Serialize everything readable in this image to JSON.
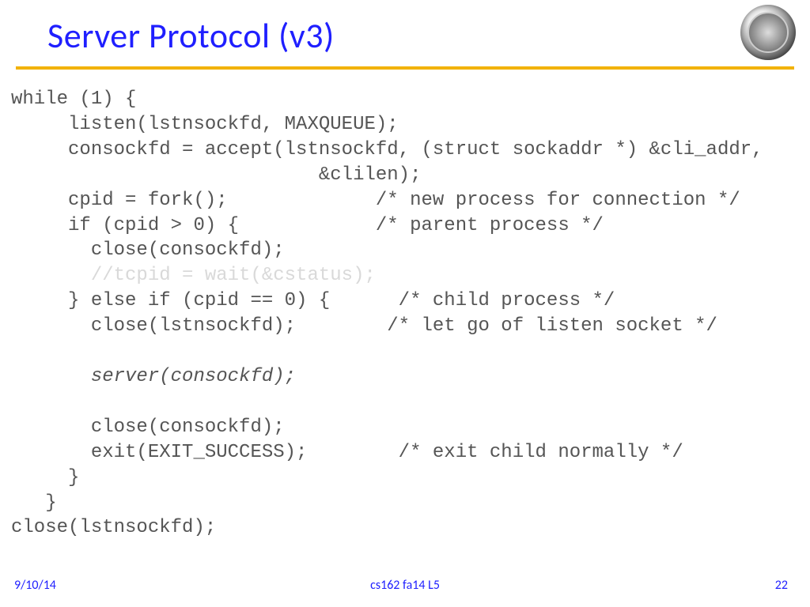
{
  "header": {
    "title": "Server Protocol (v3)",
    "logo_alt": "university-seal"
  },
  "code": {
    "l01": "while (1) {",
    "l02": "     listen(lstnsockfd, MAXQUEUE);",
    "l03": "     consockfd = accept(lstnsockfd, (struct sockaddr *) &cli_addr,",
    "l04": "                           &clilen);",
    "l05": "     cpid = fork();             /* new process for connection */",
    "l06": "     if (cpid > 0) {            /* parent process */",
    "l07": "       close(consockfd);",
    "l08": "       //tcpid = wait(&cstatus);",
    "l09": "     } else if (cpid == 0) {      /* child process */",
    "l10": "       close(lstnsockfd);        /* let go of listen socket */",
    "l11": "",
    "l12": "       server(consockfd);",
    "l13": "",
    "l14": "       close(consockfd);",
    "l15": "       exit(EXIT_SUCCESS);        /* exit child normally */",
    "l16": "     }",
    "l17": "   }",
    "l18": "close(lstnsockfd);"
  },
  "footer": {
    "date": "9/10/14",
    "course": "cs162 fa14 L5",
    "page": "22"
  }
}
